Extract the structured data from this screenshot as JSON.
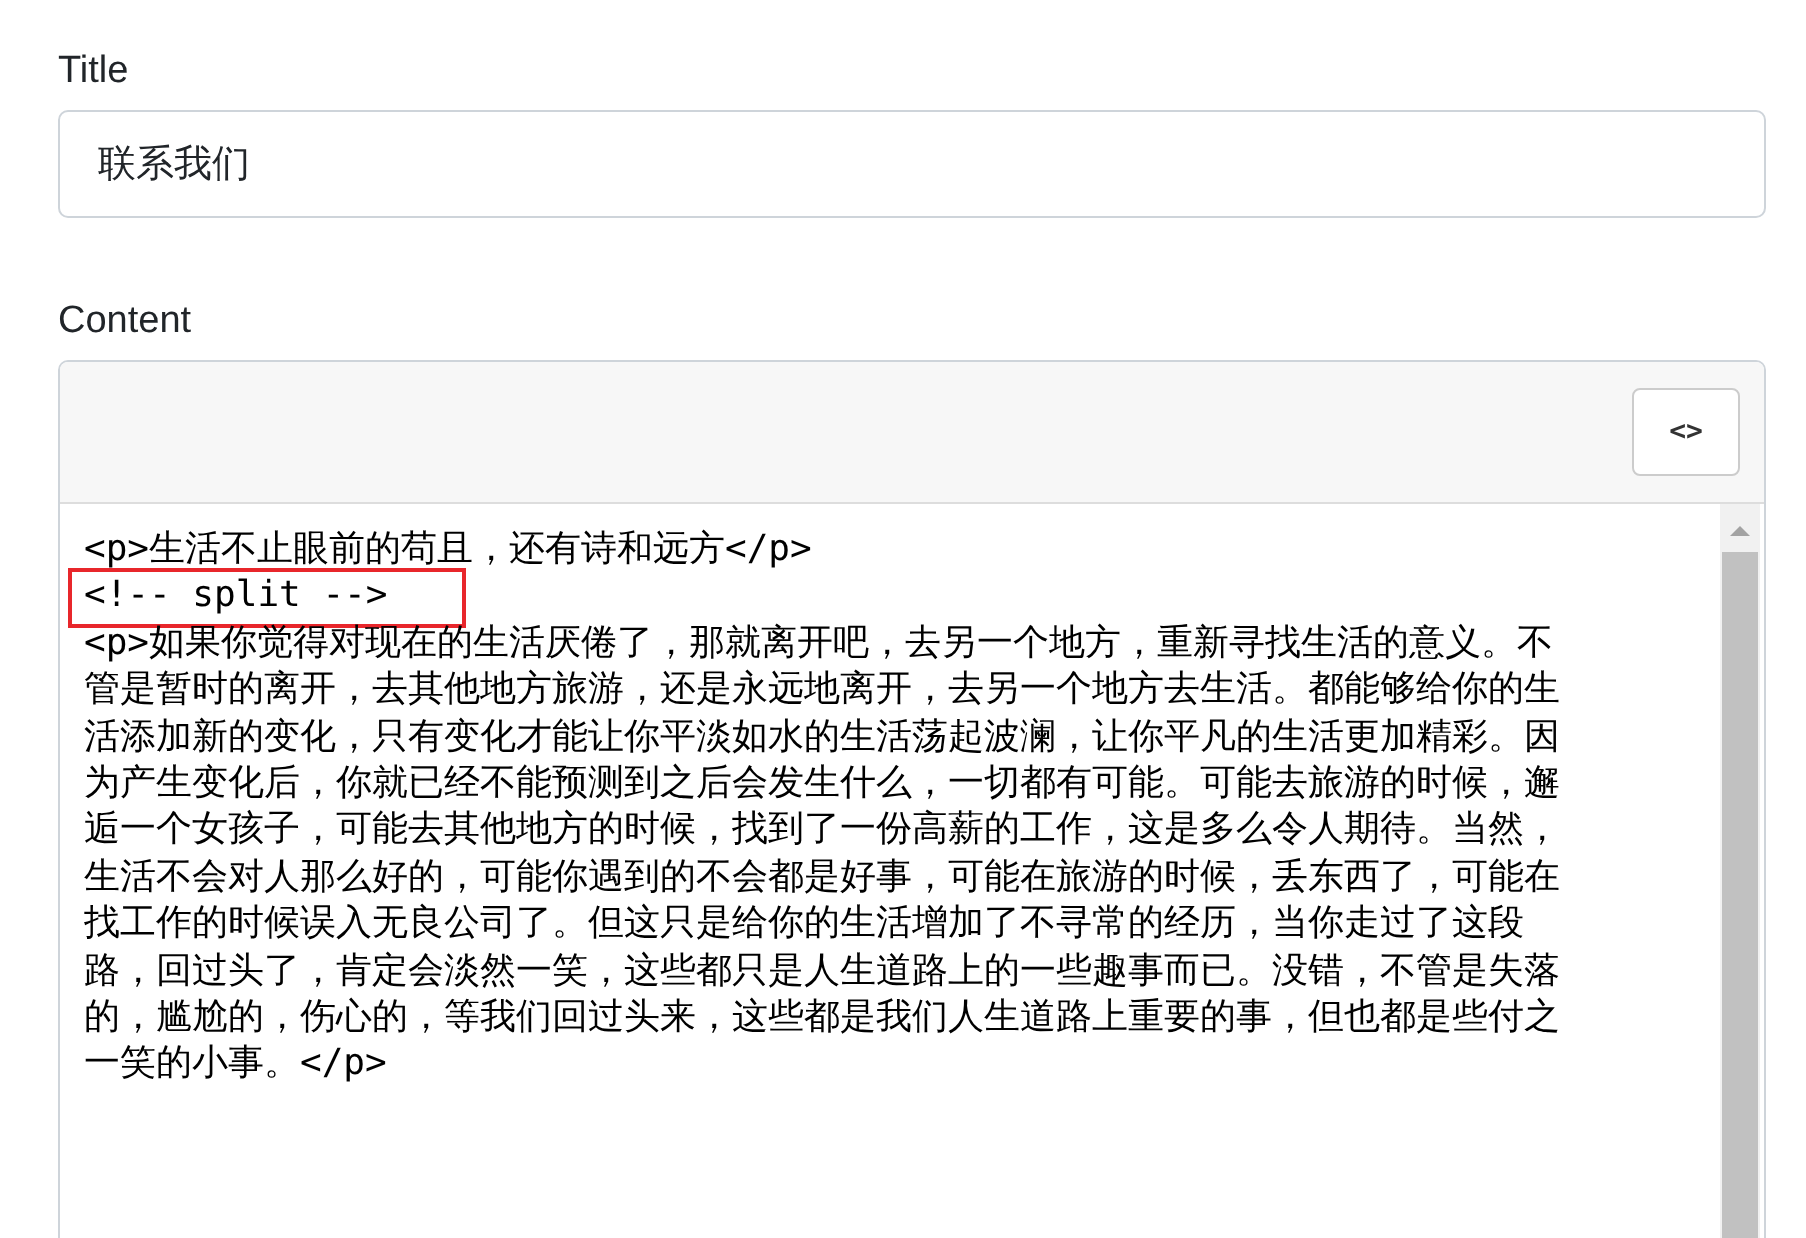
{
  "title_field": {
    "label": "Title",
    "value": "联系我们"
  },
  "content_field": {
    "label": "Content",
    "toolbar_button": "<>",
    "lines": [
      {
        "text": "<p>生活不止眼前的苟且，还有诗和远方</p>",
        "highlighted": false
      },
      {
        "text": "<!-- split -->",
        "highlighted": true
      },
      {
        "text": "<p>如果你觉得对现在的生活厌倦了，那就离开吧，去另一个地方，重新寻找生活的意义。不",
        "highlighted": false
      },
      {
        "text": "管是暂时的离开，去其他地方旅游，还是永远地离开，去另一个地方去生活。都能够给你的生",
        "highlighted": false
      },
      {
        "text": "活添加新的变化，只有变化才能让你平淡如水的生活荡起波澜，让你平凡的生活更加精彩。因",
        "highlighted": false
      },
      {
        "text": "为产生变化后，你就已经不能预测到之后会发生什么，一切都有可能。可能去旅游的时候，邂",
        "highlighted": false
      },
      {
        "text": "逅一个女孩子，可能去其他地方的时候，找到了一份高薪的工作，这是多么令人期待。当然，",
        "highlighted": false
      },
      {
        "text": "生活不会对人那么好的，可能你遇到的不会都是好事，可能在旅游的时候，丢东西了，可能在",
        "highlighted": false
      },
      {
        "text": "找工作的时候误入无良公司了。但这只是给你的生活增加了不寻常的经历，当你走过了这段",
        "highlighted": false
      },
      {
        "text": "路，回过头了，肯定会淡然一笑，这些都只是人生道路上的一些趣事而已。没错，不管是失落",
        "highlighted": false
      },
      {
        "text": "的，尴尬的，伤心的，等我们回过头来，这些都是我们人生道路上重要的事，但也都是些付之",
        "highlighted": false
      },
      {
        "text": "一笑的小事。</p>",
        "highlighted": false
      }
    ]
  }
}
